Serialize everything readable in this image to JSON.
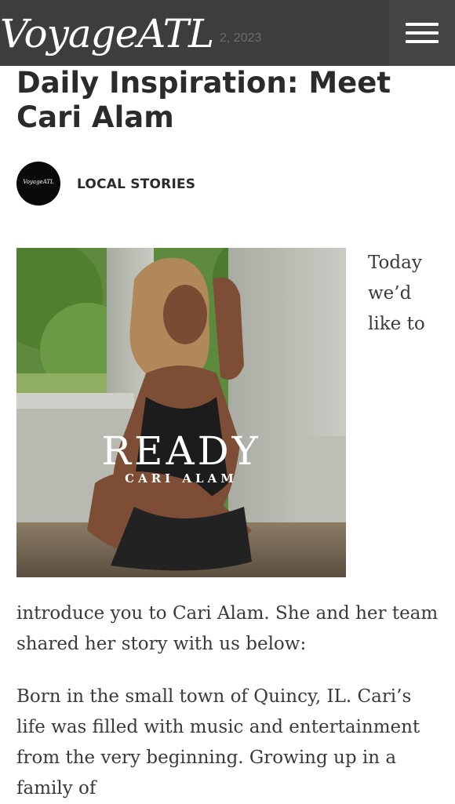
{
  "header": {
    "logo": "VoyageATL",
    "date_partial": "2, 2023",
    "menu_icon": "hamburger-menu-icon"
  },
  "article": {
    "title": "Daily Inspiration: Meet Cari Alam",
    "author_avatar_text": "VoyageATL",
    "category": "LOCAL STORIES",
    "cover_image": {
      "title": "READY",
      "subtitle": "CARI ALAM"
    },
    "float_words": [
      "Today",
      "we’d",
      "like to"
    ],
    "paragraphs": [
      "introduce you to Cari Alam. She and her team shared her story with us below:",
      "Born in the small town of Quincy, IL. Cari’s life was filled with music and entertainment from the very beginning. Growing up in a family of"
    ]
  },
  "colors": {
    "header_bg": "#3d3d3d",
    "menu_bg": "#454545",
    "title_text": "#2b2b2b",
    "body_text": "#3a3a3a"
  }
}
